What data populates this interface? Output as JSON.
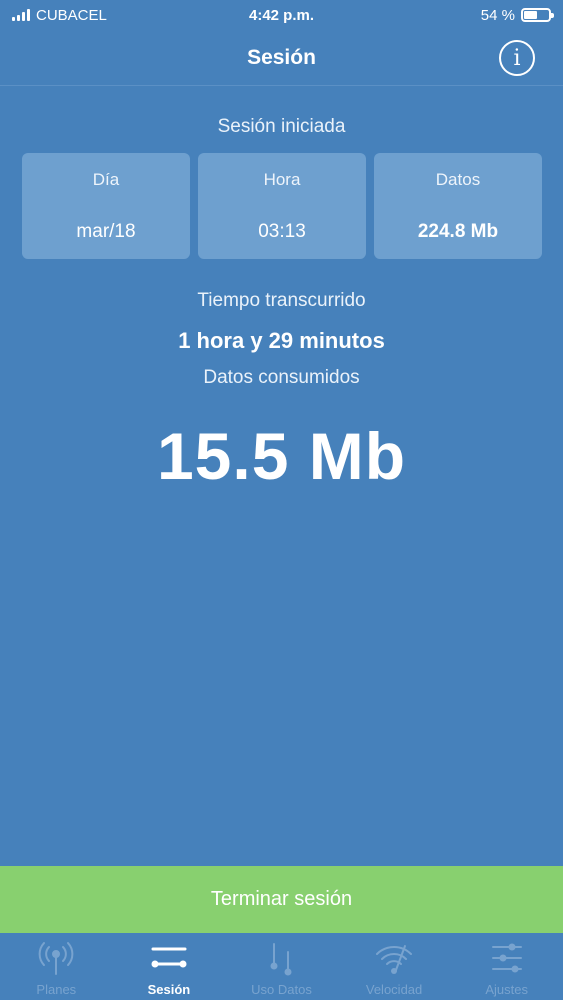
{
  "status_bar": {
    "carrier": "CUBACEL",
    "time": "4:42 p.m.",
    "battery_text": "54 %",
    "battery_level": 0.54
  },
  "nav": {
    "title": "Sesión",
    "info_icon": "info-circle-icon"
  },
  "session": {
    "title": "Sesión iniciada",
    "cards": [
      {
        "label": "Día",
        "value": "mar/18"
      },
      {
        "label": "Hora",
        "value": "03:13"
      },
      {
        "label": "Datos",
        "value": "224.8 Mb"
      }
    ],
    "elapsed_label": "Tiempo transcurrido",
    "elapsed_value": "1 hora y 29 minutos",
    "consumed_label": "Datos consumidos",
    "consumed_value": "15.5 Mb"
  },
  "end_button": {
    "label": "Terminar sesión",
    "color": "#88d06f"
  },
  "tabs": [
    {
      "label": "Planes",
      "icon": "antenna-icon",
      "active": false
    },
    {
      "label": "Sesión",
      "icon": "session-icon",
      "active": true
    },
    {
      "label": "Uso Datos",
      "icon": "data-usage-icon",
      "active": false
    },
    {
      "label": "Velocidad",
      "icon": "wifi-icon",
      "active": false
    },
    {
      "label": "Ajustes",
      "icon": "sliders-icon",
      "active": false
    }
  ],
  "colors": {
    "background": "#4681bb",
    "card": "#6ea0cf",
    "tab_inactive": "#78a3cf"
  }
}
